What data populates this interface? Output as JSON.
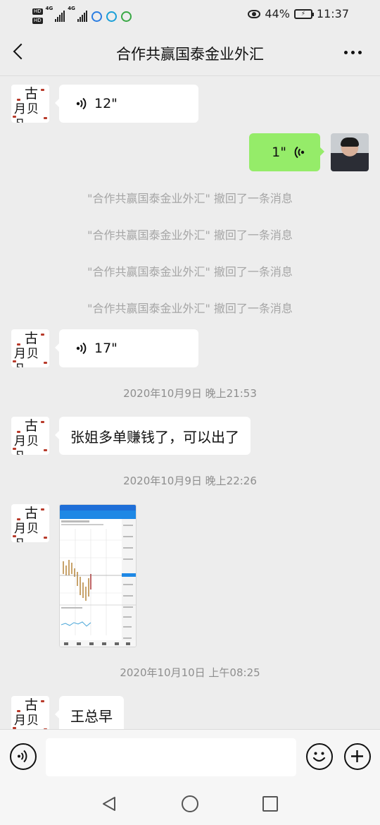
{
  "status_bar": {
    "hd1": "HD",
    "hd2": "HD",
    "net1": "4G",
    "net2": "4G",
    "battery_percent": "44%",
    "time": "11:37"
  },
  "header": {
    "title": "合作共赢国泰金业外汇"
  },
  "messages": {
    "voice_in_1": "12\"",
    "voice_out_1": "1\"",
    "recall_1": "\"合作共赢国泰金业外汇\" 撤回了一条消息",
    "recall_2": "\"合作共赢国泰金业外汇\" 撤回了一条消息",
    "recall_3": "\"合作共赢国泰金业外汇\" 撤回了一条消息",
    "recall_4": "\"合作共赢国泰金业外汇\" 撤回了一条消息",
    "voice_in_2": "17\"",
    "time_1": "2020年10月9日 晚上21:53",
    "text_1": "张姐多单赚钱了，可以出了",
    "time_2": "2020年10月9日 晚上22:26",
    "time_3": "2020年10月10日 上午08:25",
    "text_2": "王总早"
  },
  "avatar": {
    "top_char": "古",
    "bottom_chars": "月贝凡"
  },
  "colors": {
    "chat_bg": "#ededed",
    "outgoing_bubble": "#95ec69",
    "incoming_bubble": "#ffffff",
    "system_text": "#a6a6a6"
  },
  "icons": {
    "back": "back-arrow-icon",
    "more": "more-dots-icon",
    "voice": "voice-wave-icon",
    "emoji": "emoji-icon",
    "plus": "plus-icon",
    "voice_input": "voice-input-icon"
  }
}
